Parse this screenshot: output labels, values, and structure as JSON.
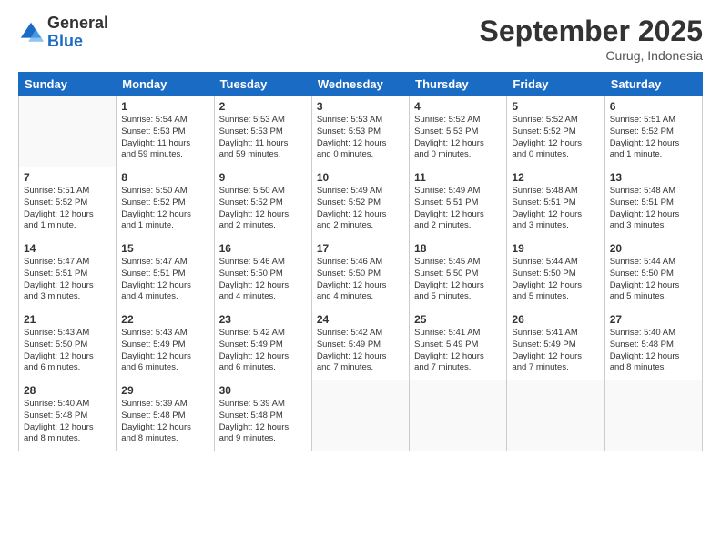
{
  "logo": {
    "general": "General",
    "blue": "Blue"
  },
  "header": {
    "month_title": "September 2025",
    "subtitle": "Curug, Indonesia"
  },
  "weekdays": [
    "Sunday",
    "Monday",
    "Tuesday",
    "Wednesday",
    "Thursday",
    "Friday",
    "Saturday"
  ],
  "weeks": [
    [
      {
        "day": "",
        "info": ""
      },
      {
        "day": "1",
        "info": "Sunrise: 5:54 AM\nSunset: 5:53 PM\nDaylight: 11 hours\nand 59 minutes."
      },
      {
        "day": "2",
        "info": "Sunrise: 5:53 AM\nSunset: 5:53 PM\nDaylight: 11 hours\nand 59 minutes."
      },
      {
        "day": "3",
        "info": "Sunrise: 5:53 AM\nSunset: 5:53 PM\nDaylight: 12 hours\nand 0 minutes."
      },
      {
        "day": "4",
        "info": "Sunrise: 5:52 AM\nSunset: 5:53 PM\nDaylight: 12 hours\nand 0 minutes."
      },
      {
        "day": "5",
        "info": "Sunrise: 5:52 AM\nSunset: 5:52 PM\nDaylight: 12 hours\nand 0 minutes."
      },
      {
        "day": "6",
        "info": "Sunrise: 5:51 AM\nSunset: 5:52 PM\nDaylight: 12 hours\nand 1 minute."
      }
    ],
    [
      {
        "day": "7",
        "info": "Sunrise: 5:51 AM\nSunset: 5:52 PM\nDaylight: 12 hours\nand 1 minute."
      },
      {
        "day": "8",
        "info": "Sunrise: 5:50 AM\nSunset: 5:52 PM\nDaylight: 12 hours\nand 1 minute."
      },
      {
        "day": "9",
        "info": "Sunrise: 5:50 AM\nSunset: 5:52 PM\nDaylight: 12 hours\nand 2 minutes."
      },
      {
        "day": "10",
        "info": "Sunrise: 5:49 AM\nSunset: 5:52 PM\nDaylight: 12 hours\nand 2 minutes."
      },
      {
        "day": "11",
        "info": "Sunrise: 5:49 AM\nSunset: 5:51 PM\nDaylight: 12 hours\nand 2 minutes."
      },
      {
        "day": "12",
        "info": "Sunrise: 5:48 AM\nSunset: 5:51 PM\nDaylight: 12 hours\nand 3 minutes."
      },
      {
        "day": "13",
        "info": "Sunrise: 5:48 AM\nSunset: 5:51 PM\nDaylight: 12 hours\nand 3 minutes."
      }
    ],
    [
      {
        "day": "14",
        "info": "Sunrise: 5:47 AM\nSunset: 5:51 PM\nDaylight: 12 hours\nand 3 minutes."
      },
      {
        "day": "15",
        "info": "Sunrise: 5:47 AM\nSunset: 5:51 PM\nDaylight: 12 hours\nand 4 minutes."
      },
      {
        "day": "16",
        "info": "Sunrise: 5:46 AM\nSunset: 5:50 PM\nDaylight: 12 hours\nand 4 minutes."
      },
      {
        "day": "17",
        "info": "Sunrise: 5:46 AM\nSunset: 5:50 PM\nDaylight: 12 hours\nand 4 minutes."
      },
      {
        "day": "18",
        "info": "Sunrise: 5:45 AM\nSunset: 5:50 PM\nDaylight: 12 hours\nand 5 minutes."
      },
      {
        "day": "19",
        "info": "Sunrise: 5:44 AM\nSunset: 5:50 PM\nDaylight: 12 hours\nand 5 minutes."
      },
      {
        "day": "20",
        "info": "Sunrise: 5:44 AM\nSunset: 5:50 PM\nDaylight: 12 hours\nand 5 minutes."
      }
    ],
    [
      {
        "day": "21",
        "info": "Sunrise: 5:43 AM\nSunset: 5:50 PM\nDaylight: 12 hours\nand 6 minutes."
      },
      {
        "day": "22",
        "info": "Sunrise: 5:43 AM\nSunset: 5:49 PM\nDaylight: 12 hours\nand 6 minutes."
      },
      {
        "day": "23",
        "info": "Sunrise: 5:42 AM\nSunset: 5:49 PM\nDaylight: 12 hours\nand 6 minutes."
      },
      {
        "day": "24",
        "info": "Sunrise: 5:42 AM\nSunset: 5:49 PM\nDaylight: 12 hours\nand 7 minutes."
      },
      {
        "day": "25",
        "info": "Sunrise: 5:41 AM\nSunset: 5:49 PM\nDaylight: 12 hours\nand 7 minutes."
      },
      {
        "day": "26",
        "info": "Sunrise: 5:41 AM\nSunset: 5:49 PM\nDaylight: 12 hours\nand 7 minutes."
      },
      {
        "day": "27",
        "info": "Sunrise: 5:40 AM\nSunset: 5:48 PM\nDaylight: 12 hours\nand 8 minutes."
      }
    ],
    [
      {
        "day": "28",
        "info": "Sunrise: 5:40 AM\nSunset: 5:48 PM\nDaylight: 12 hours\nand 8 minutes."
      },
      {
        "day": "29",
        "info": "Sunrise: 5:39 AM\nSunset: 5:48 PM\nDaylight: 12 hours\nand 8 minutes."
      },
      {
        "day": "30",
        "info": "Sunrise: 5:39 AM\nSunset: 5:48 PM\nDaylight: 12 hours\nand 9 minutes."
      },
      {
        "day": "",
        "info": ""
      },
      {
        "day": "",
        "info": ""
      },
      {
        "day": "",
        "info": ""
      },
      {
        "day": "",
        "info": ""
      }
    ]
  ]
}
